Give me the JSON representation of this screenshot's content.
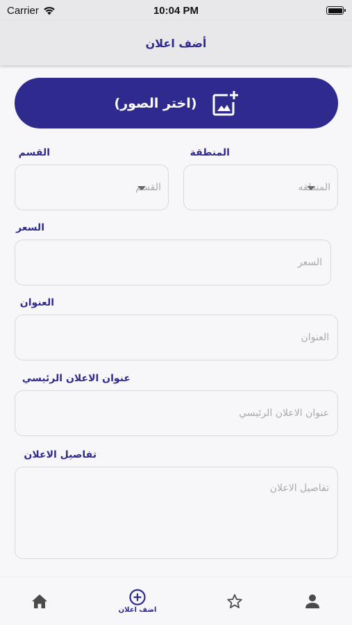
{
  "status_bar": {
    "carrier": "Carrier",
    "time": "10:04 PM"
  },
  "nav": {
    "title": "أضف اعلان"
  },
  "image_picker": {
    "label": "(اختر الصور)",
    "icon": "add-photo-icon"
  },
  "form": {
    "region": {
      "label": "المنطقة",
      "placeholder": "المنطقه"
    },
    "category": {
      "label": "القسم",
      "placeholder": "القسم"
    },
    "price": {
      "label": "السعر",
      "placeholder": "السعر"
    },
    "address": {
      "label": "العنوان",
      "placeholder": "العنوان"
    },
    "main_title": {
      "label": "عنوان الاعلان الرئيسي",
      "placeholder": "عنوان الاعلان الرئيسي"
    },
    "details": {
      "label": "تفاصيل الاعلان",
      "placeholder": "تفاصيل الاعلان"
    }
  },
  "tabs": [
    {
      "icon": "home-icon",
      "label": ""
    },
    {
      "icon": "add-circle-icon",
      "label": "اضف اعلان"
    },
    {
      "icon": "star-icon",
      "label": ""
    },
    {
      "icon": "person-icon",
      "label": ""
    }
  ],
  "colors": {
    "primary": "#2f2a8e",
    "background": "#f7f7f9",
    "border": "#d9d9dd",
    "placeholder": "#a9a9ad"
  }
}
